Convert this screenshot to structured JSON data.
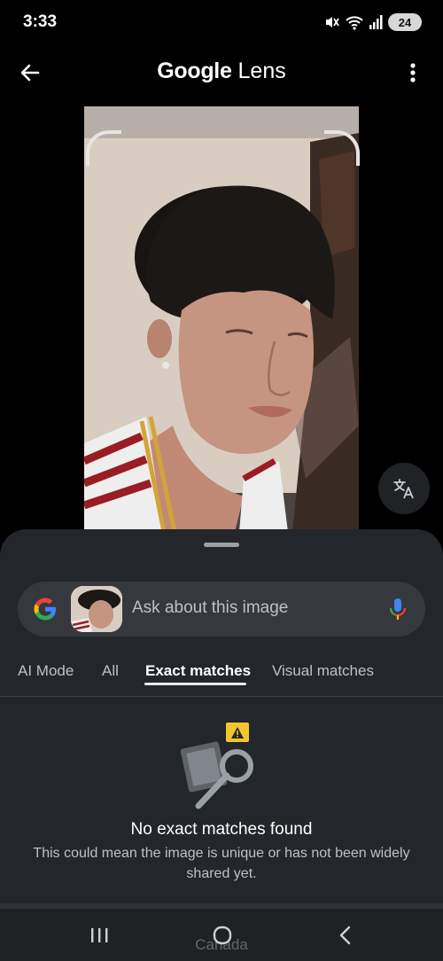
{
  "status_bar": {
    "time": "3:33",
    "battery": "24",
    "icons": [
      "mute-icon",
      "wifi-icon",
      "signal-icon",
      "battery-icon"
    ]
  },
  "header": {
    "title_brand": "Google",
    "title_product": "Lens",
    "back_icon": "arrow-left-icon",
    "menu_icon": "more-vertical-icon"
  },
  "image_viewer": {
    "translate_icon": "translate-icon"
  },
  "search": {
    "placeholder": "Ask about this image",
    "logo_icon": "google-g-icon",
    "mic_icon": "mic-icon"
  },
  "tabs": [
    {
      "label": "AI Mode",
      "active": false
    },
    {
      "label": "All",
      "active": false
    },
    {
      "label": "Exact matches",
      "active": true
    },
    {
      "label": "Visual matches",
      "active": false
    }
  ],
  "results": {
    "empty_title": "No exact matches found",
    "empty_description": "This could mean the image is unique or has not been widely shared yet."
  },
  "partial_text": "Canada",
  "nav_bar": {
    "icons": [
      "recents-icon",
      "home-icon",
      "back-icon"
    ]
  },
  "colors": {
    "background": "#000000",
    "sheet": "#23262a",
    "search_bar": "#35383d",
    "text_secondary": "#bdc1c6",
    "warning": "#f4c430"
  }
}
